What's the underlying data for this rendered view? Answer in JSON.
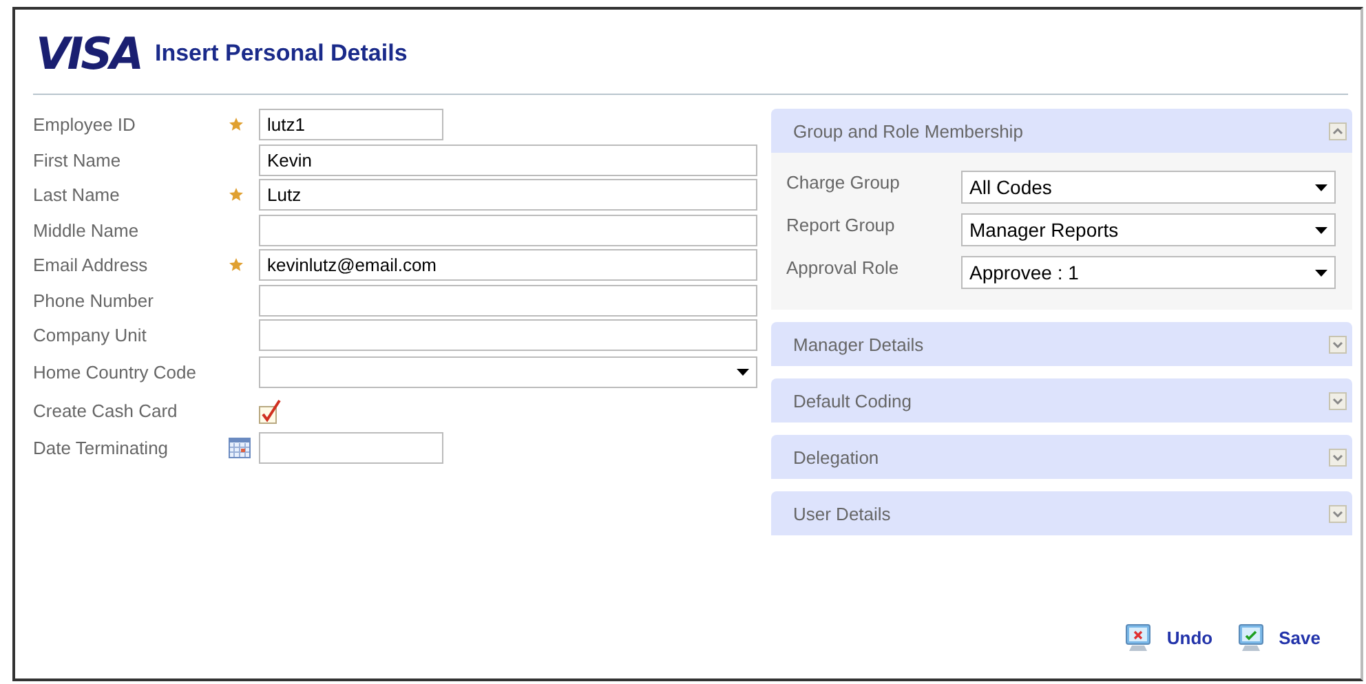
{
  "header": {
    "logo": "VISA",
    "title": "Insert Personal Details"
  },
  "fields": [
    {
      "label": "Employee ID",
      "kind": "short_text",
      "required": true,
      "value": "lutz1"
    },
    {
      "label": "First Name",
      "kind": "text",
      "required": false,
      "value": "Kevin"
    },
    {
      "label": "Last Name",
      "kind": "text",
      "required": true,
      "value": "Lutz"
    },
    {
      "label": "Middle Name",
      "kind": "text",
      "required": false
    },
    {
      "label": "Email Address",
      "kind": "text",
      "required": true,
      "value": "kevinlutz@email.com"
    },
    {
      "label": "Phone Number",
      "kind": "text",
      "required": false
    },
    {
      "label": "Company Unit",
      "kind": "text",
      "required": false
    },
    {
      "label": "Home Country Code",
      "kind": "select",
      "required": false
    },
    {
      "label": "Create Cash Card",
      "kind": "checkbox",
      "required": false,
      "checked": true
    },
    {
      "label": "Date Terminating",
      "kind": "date",
      "required": false
    }
  ],
  "sections": [
    {
      "title": "Group and Role Membership",
      "expanded": true,
      "fields": [
        {
          "label": "Charge Group",
          "value": "All Codes"
        },
        {
          "label": "Report Group",
          "value": "Manager Reports"
        },
        {
          "label": "Approval Role",
          "value": "Approvee : 1"
        }
      ]
    },
    {
      "title": "Manager Details",
      "expanded": false
    },
    {
      "title": "Default Coding",
      "expanded": false
    },
    {
      "title": "Delegation",
      "expanded": false
    },
    {
      "title": "User Details",
      "expanded": false
    }
  ],
  "actions": [
    {
      "kind": "undo",
      "label": "Undo"
    },
    {
      "kind": "save",
      "label": "Save"
    }
  ]
}
